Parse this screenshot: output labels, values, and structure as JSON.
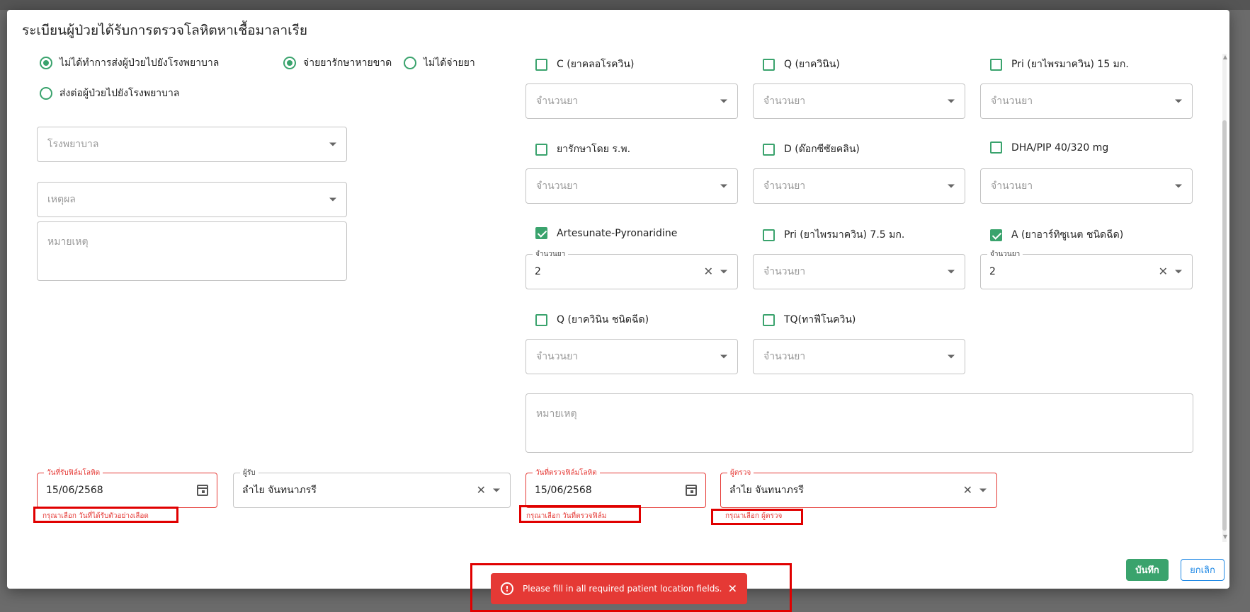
{
  "dialog": {
    "title": "ระเบียนผู้ป่วยได้รับการตรวจโลหิตหาเชื้อมาลาเรีย"
  },
  "referral": {
    "not_referred": "ไม่ได้ทำการส่งผู้ป่วยไปยังโรงพยาบาล",
    "referred": "ส่งต่อผู้ป่วยไปยังโรงพยาบาล",
    "selected": "not_referred"
  },
  "dispense": {
    "radical": "จ่ายยารักษาหายขาด",
    "none": "ไม่ได้จ่ายยา",
    "selected": "radical"
  },
  "left_fields": {
    "hospital_placeholder": "โรงพยาบาล",
    "reason_placeholder": "เหตุผล",
    "note_placeholder": "หมายเหตุ"
  },
  "drugs": [
    {
      "label": "C (ยาคลอโรควิน)",
      "checked": false,
      "qty": "",
      "qty_placeholder": "จำนวนยา"
    },
    {
      "label": "Q (ยาควินิน)",
      "checked": false,
      "qty": "",
      "qty_placeholder": "จำนวนยา"
    },
    {
      "label": "Pri (ยาไพรมาควิน) 15 มก.",
      "checked": false,
      "qty": "",
      "qty_placeholder": "จำนวนยา"
    },
    {
      "label": "ยารักษาโดย ร.พ.",
      "checked": false,
      "qty": "",
      "qty_placeholder": "จำนวนยา"
    },
    {
      "label": "D (ด๊อกซีซัยคลิน)",
      "checked": false,
      "qty": "",
      "qty_placeholder": "จำนวนยา"
    },
    {
      "label": "DHA/PIP 40/320 mg",
      "checked": false,
      "qty": "",
      "qty_placeholder": "จำนวนยา"
    },
    {
      "label": "Artesunate-Pyronaridine",
      "checked": true,
      "qty": "2",
      "qty_legend": "จำนวนยา"
    },
    {
      "label": "Pri (ยาไพรมาควิน) 7.5 มก.",
      "checked": false,
      "qty": "",
      "qty_placeholder": "จำนวนยา"
    },
    {
      "label": "A (ยาอาร์ทิซูเนต ชนิดฉีด)",
      "checked": true,
      "qty": "2",
      "qty_legend": "จำนวนยา"
    },
    {
      "label": "Q (ยาควินิน ชนิดฉีด)",
      "checked": false,
      "qty": "",
      "qty_placeholder": "จำนวนยา"
    },
    {
      "label": "TQ(ทาฟีโนควิน)",
      "checked": false,
      "qty": "",
      "qty_placeholder": "จำนวนยา"
    }
  ],
  "drug_note_placeholder": "หมายเหตุ",
  "bottom": {
    "receive_date_legend": "วันที่รับฟิล์มโลหิต",
    "receive_date_value": "15/06/2568",
    "receive_date_error": "กรุณาเลือก วันที่ได้รับตัวอย่างเลือด",
    "receiver_legend": "ผู้รับ",
    "receiver_value": "ลำไย จันทนาภรรี",
    "exam_date_legend": "วันที่ตรวจฟิล์มโลหิต",
    "exam_date_value": "15/06/2568",
    "exam_date_error": "กรุณาเลือก วันที่ตรวจฟิล์ม",
    "examiner_legend": "ผู้ตรวจ",
    "examiner_value": "ลำไย จันทนาภรรี",
    "examiner_error": "กรุณาเลือก ผู้ตรวจ"
  },
  "actions": {
    "save": "บันทึก",
    "cancel": "ยกเลิก"
  },
  "toast": {
    "icon": "!",
    "message": "Please fill in all required patient location fields.",
    "close": "✕"
  },
  "colors": {
    "accent": "#3aa36d",
    "error": "#e53935",
    "link": "#1e88e5"
  }
}
